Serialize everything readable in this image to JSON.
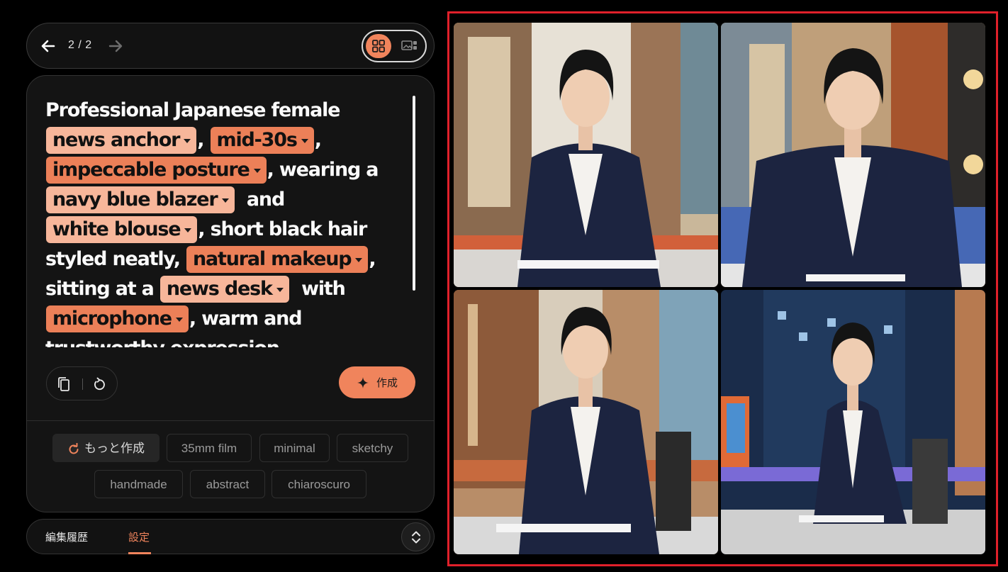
{
  "nav": {
    "counter": "2 / 2"
  },
  "prompt": {
    "segments": [
      {
        "t": "Professional Japanese female"
      },
      {
        "br": true
      },
      {
        "chip": "news anchor",
        "s": "light"
      },
      {
        "t": ", "
      },
      {
        "chip": "mid-30s",
        "s": "dark"
      },
      {
        "t": ","
      },
      {
        "br": true
      },
      {
        "chip": "impeccable posture",
        "s": "dark"
      },
      {
        "t": ", wearing a"
      },
      {
        "br": true
      },
      {
        "chip": "navy blue blazer",
        "s": "light"
      },
      {
        "t": "  and"
      },
      {
        "br": true
      },
      {
        "chip": "white blouse",
        "s": "light"
      },
      {
        "t": ", short black hair"
      },
      {
        "br": true
      },
      {
        "t": "styled neatly, "
      },
      {
        "chip": "natural makeup",
        "s": "dark"
      },
      {
        "t": ","
      },
      {
        "br": true
      },
      {
        "t": "sitting at a "
      },
      {
        "chip": "news desk",
        "s": "light"
      },
      {
        "t": "  with"
      },
      {
        "br": true
      },
      {
        "chip": "microphone",
        "s": "dark"
      },
      {
        "t": ", warm and"
      },
      {
        "br": true
      },
      {
        "t": "trustworthy expression"
      }
    ]
  },
  "actions": {
    "create_label": "作成"
  },
  "styles": {
    "more_label": "もっと作成",
    "chips": [
      "35mm film",
      "minimal",
      "sketchy",
      "handmade",
      "abstract",
      "chiaroscuro"
    ]
  },
  "tabs": {
    "history": "編集履歴",
    "settings": "設定"
  },
  "colors": {
    "accent": "#f0845c",
    "chip_dark": "#ec8058",
    "chip_light": "#f7b69a",
    "selection": "#e0202a"
  }
}
